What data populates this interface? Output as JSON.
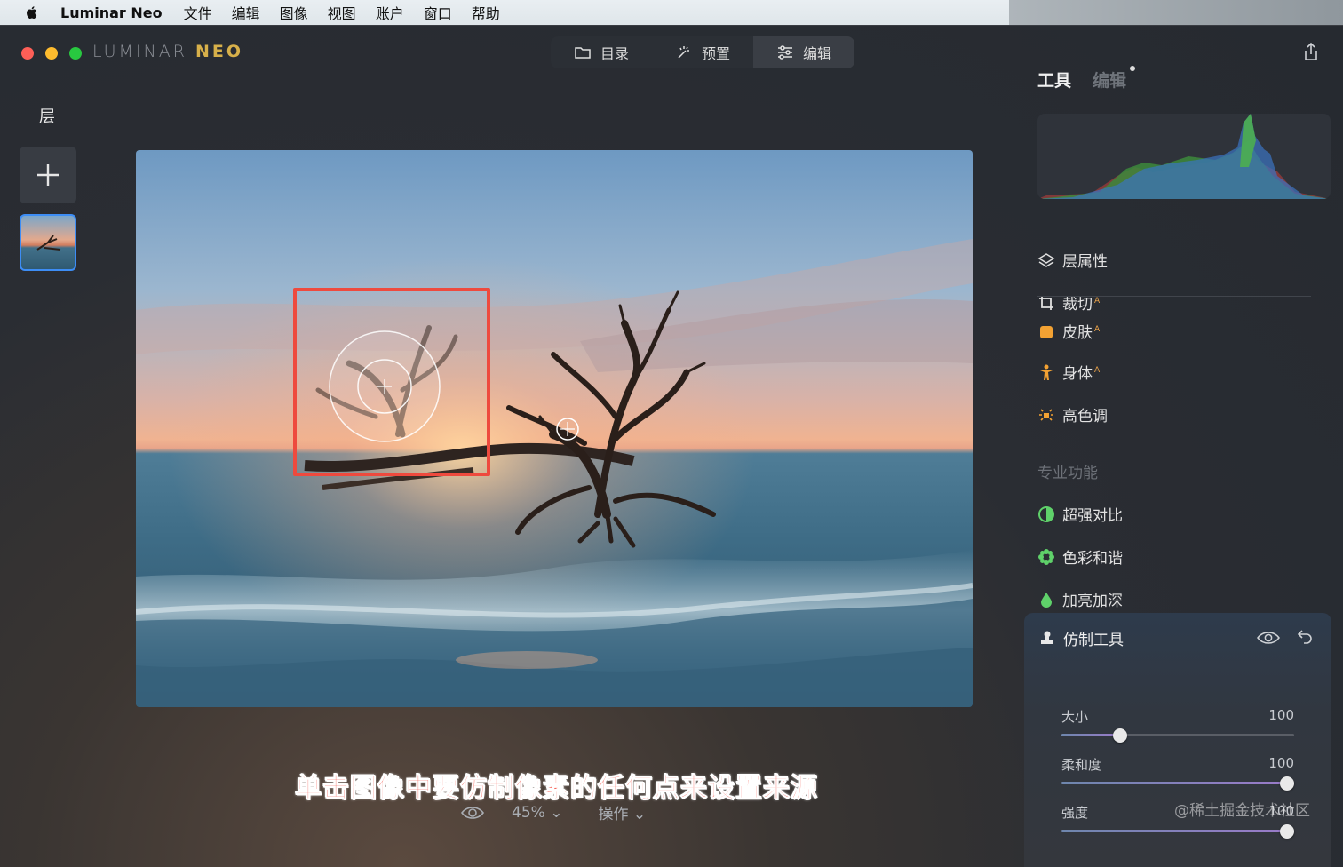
{
  "menubar": {
    "app_name": "Luminar Neo",
    "items": [
      "文件",
      "编辑",
      "图像",
      "视图",
      "账户",
      "窗口",
      "帮助"
    ]
  },
  "window": {
    "brand_left": "LUMINAR",
    "brand_right": "NEO",
    "tabs": [
      {
        "label": "目录",
        "icon": "folder-icon",
        "active": false
      },
      {
        "label": "预置",
        "icon": "sparkle-icon",
        "active": false
      },
      {
        "label": "编辑",
        "icon": "sliders-icon",
        "active": true
      }
    ]
  },
  "left_panel": {
    "title": "层"
  },
  "canvas": {
    "caption": "单击图像中要仿制像素的任何点来设置来源",
    "zoom": "45%",
    "actions": "操作"
  },
  "right_panel": {
    "tab_tools": "工具",
    "tab_edits": "编辑",
    "tools": [
      {
        "label": "层属性",
        "icon": "layers-icon",
        "ai": ""
      },
      {
        "label": "裁切",
        "icon": "crop-icon",
        "ai": "AI"
      },
      {
        "label": "皮肤",
        "icon": "skin-icon",
        "ai": "AI"
      },
      {
        "label": "身体",
        "icon": "body-icon",
        "ai": "AI"
      },
      {
        "label": "高色调",
        "icon": "high-key-icon",
        "ai": ""
      }
    ],
    "section_pro": "专业功能",
    "pro_tools": [
      {
        "label": "超强对比",
        "icon": "contrast-icon"
      },
      {
        "label": "色彩和谐",
        "icon": "flower-icon"
      },
      {
        "label": "加亮加深",
        "icon": "drop-icon"
      }
    ],
    "clone_panel": {
      "title": "仿制工具",
      "sliders": [
        {
          "label": "大小",
          "value": "100",
          "level": 0.25
        },
        {
          "label": "柔和度",
          "value": "100",
          "level": 0.97
        },
        {
          "label": "强度",
          "value": "100",
          "level": 0.97
        }
      ]
    }
  },
  "watermark": "@稀土掘金技术社区",
  "colors": {
    "accent_blue": "#3d8df5",
    "highlight_red": "#ee4a3e",
    "ai_badge": "#f0a64a"
  }
}
